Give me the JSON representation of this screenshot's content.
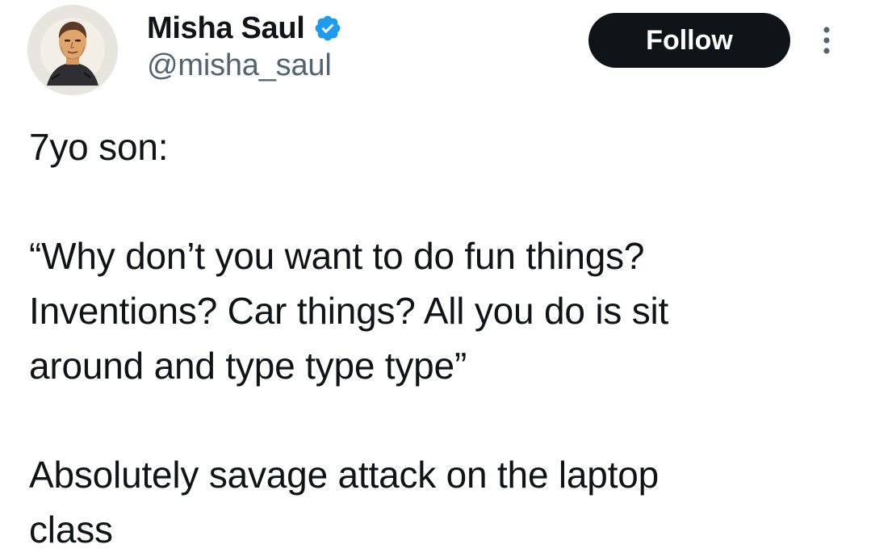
{
  "author": {
    "display_name": "Misha Saul",
    "handle": "@misha_saul",
    "verified": true,
    "verified_color": "#1d9bf0"
  },
  "actions": {
    "follow_label": "Follow",
    "more_icon": "more-vertical-icon"
  },
  "tweet": {
    "paragraphs": [
      [
        "7yo son:"
      ],
      [
        "“Why don’t you want to do fun things?",
        "Inventions? Car things? All you do is sit",
        "around and type type type”"
      ],
      [
        "Absolutely savage attack on the laptop",
        "class"
      ]
    ]
  },
  "colors": {
    "text": "#0f1419",
    "secondary_text": "#536471",
    "button_bg": "#0f1419",
    "button_text": "#ffffff"
  }
}
